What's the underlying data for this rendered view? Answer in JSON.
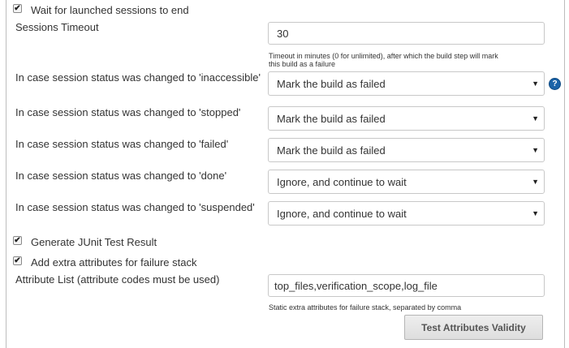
{
  "wait": {
    "label": "Wait for launched sessions to end",
    "checked": true
  },
  "timeout": {
    "label": "Sessions Timeout",
    "value": "30",
    "hint_line1": "Timeout in minutes (0 for unlimited), after which the build step will mark",
    "hint_line2": "this build as a failure"
  },
  "status_rows": [
    {
      "label": "In case session status was changed to 'inaccessible'",
      "value": "Mark the build as failed"
    },
    {
      "label": "In case session status was changed to 'stopped'",
      "value": "Mark the build as failed"
    },
    {
      "label": "In case session status was changed to 'failed'",
      "value": "Mark the build as failed"
    },
    {
      "label": "In case session status was changed to 'done'",
      "value": "Ignore, and continue to wait"
    },
    {
      "label": "In case session status was changed to 'suspended'",
      "value": "Ignore, and continue to wait"
    }
  ],
  "help_icon": {
    "name": "question-icon",
    "glyph": "?"
  },
  "dropdown_icon": {
    "name": "caret-down-icon",
    "glyph": "▼"
  },
  "junit": {
    "label": "Generate JUnit Test Result",
    "checked": true
  },
  "extra": {
    "label": "Add extra attributes for failure stack",
    "checked": true
  },
  "attributes": {
    "label": "Attribute List (attribute codes must be used)",
    "value": "top_files,verification_scope,log_file",
    "hint": "Static extra attributes for failure stack, separated by comma"
  },
  "test_button": {
    "label": "Test Attributes Validity"
  },
  "colors": {
    "help_icon": "#1b63a8",
    "border": "#c8c8c8"
  }
}
